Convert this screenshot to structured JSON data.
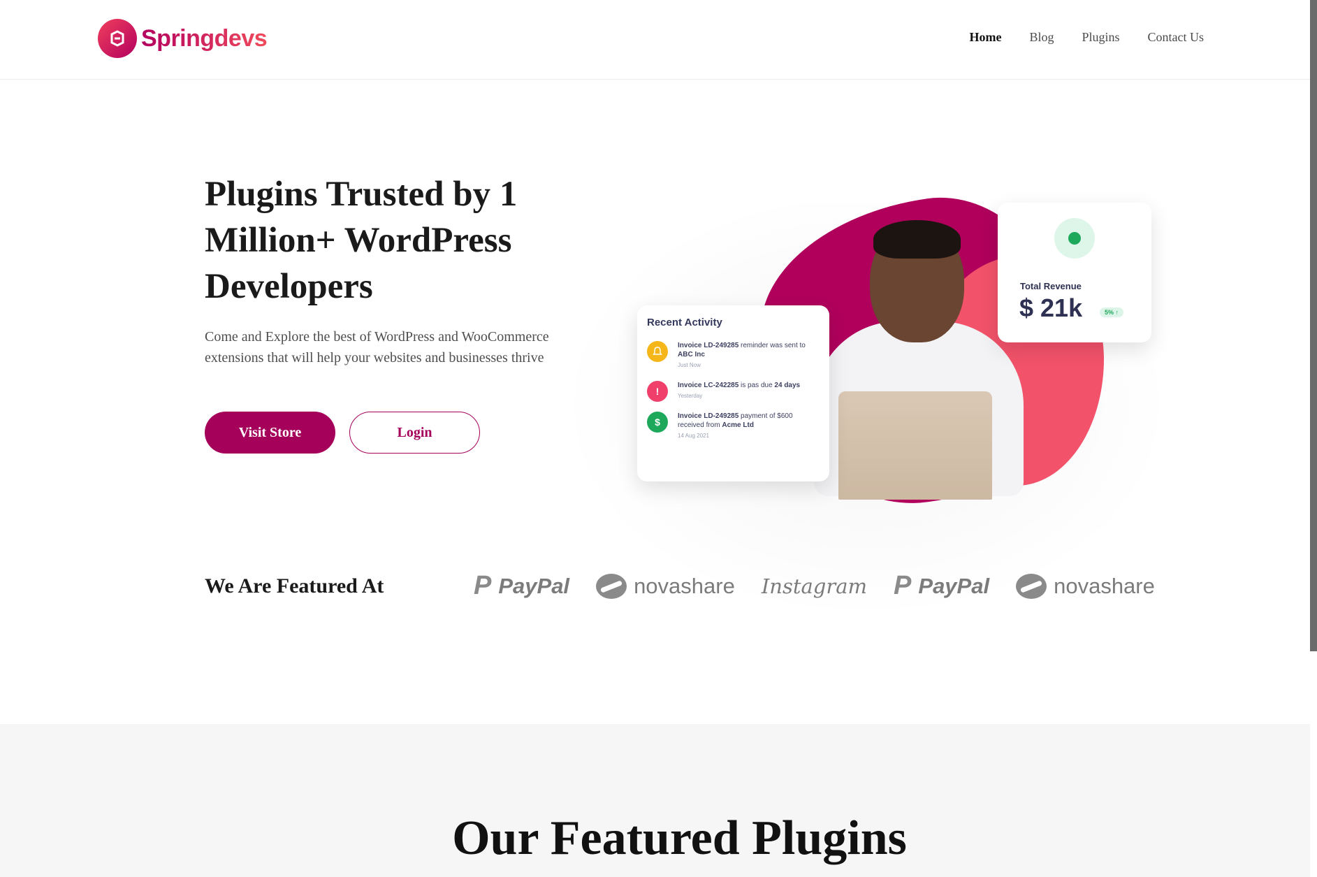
{
  "brand": {
    "name": "Springdevs"
  },
  "nav": [
    {
      "label": "Home",
      "active": true
    },
    {
      "label": "Blog",
      "active": false
    },
    {
      "label": "Plugins",
      "active": false
    },
    {
      "label": "Contact Us",
      "active": false
    }
  ],
  "hero": {
    "title": "Plugins Trusted by 1 Million+ WordPress Developers",
    "subtitle": "Come and Explore the best of WordPress and WooCommerce extensions that will help your websites and businesses thrive",
    "primary_button": "Visit Store",
    "secondary_button": "Login"
  },
  "activity_card": {
    "title": "Recent Activity",
    "items": [
      {
        "icon": "bell-icon",
        "color": "#f5b619",
        "text_a": "Invoice LD-249285",
        "text_b": " reminder was sent to ",
        "text_c": "ABC Inc",
        "time": "Just Now"
      },
      {
        "icon": "alert-icon",
        "color": "#ef3f6a",
        "text_a": "Invoice LC-242285",
        "text_b": " is pas due ",
        "text_c": "24 days",
        "time": "Yesterday"
      },
      {
        "icon": "dollar-icon",
        "color": "#1ea85b",
        "text_a": "Invoice LD-249285",
        "text_b": " payment of $600 received from ",
        "text_c": "Acme Ltd",
        "time": "14 Aug 2021"
      }
    ]
  },
  "revenue_card": {
    "label": "Total Revenue",
    "value": "$ 21k",
    "badge": "5% ↑"
  },
  "featured": {
    "heading": "We Are Featured At",
    "logos": [
      "PayPal",
      "novashare",
      "Instagram",
      "PayPal",
      "novashare"
    ]
  },
  "section2": {
    "title": "Our Featured Plugins"
  },
  "colors": {
    "primary": "#a5005a",
    "accent": "#f2526a"
  }
}
